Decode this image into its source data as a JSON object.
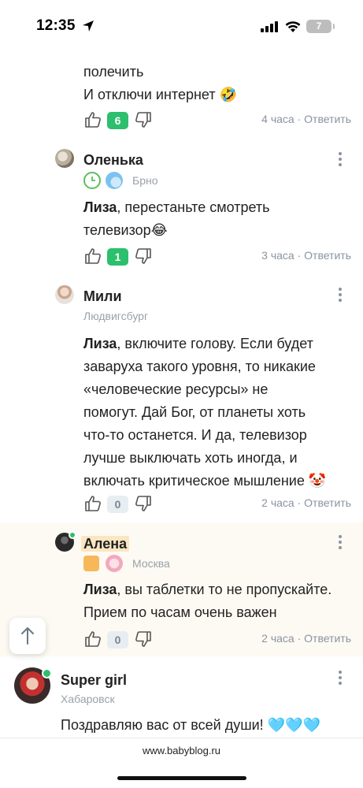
{
  "status_bar": {
    "time": "12:35",
    "battery": "7"
  },
  "comments": [
    {
      "id": "partial",
      "lines": [
        "полечить",
        "И отключи интернет 🤣"
      ],
      "rating": "6",
      "time": "4 часа",
      "reply": "Ответить"
    },
    {
      "id": "olenka",
      "author": "Оленька",
      "location": "Брно",
      "mention": "Лиза",
      "lines": [
        ", перестаньте смотреть",
        "телевизор😂"
      ],
      "rating": "1",
      "time": "3 часа",
      "reply": "Ответить"
    },
    {
      "id": "mili",
      "author": "Мили",
      "location": "Людвигсбург",
      "mention": "Лиза",
      "lines": [
        ", включите голову. Если будет",
        "заваруха такого уровня, то никакие",
        "«человеческие ресурсы» не",
        "помогут. Дай Бог, от планеты хоть",
        "что-то останется. И да, телевизор",
        "лучше выключать хоть иногда, и",
        "включать критическое мышление 🤡"
      ],
      "rating": "0",
      "time": "2 часа",
      "reply": "Ответить"
    },
    {
      "id": "alena",
      "author": "Алена",
      "location": "Москва",
      "mention": "Лиза",
      "lines": [
        ", вы таблетки то не пропускайте.",
        "Прием по часам очень важен"
      ],
      "rating": "0",
      "time": "2 часа",
      "reply": "Ответить"
    },
    {
      "id": "supergirl",
      "author": "Super girl",
      "location": "Хабаровск",
      "lines": [
        "Поздравляю вас от всей души! 🩵🩵🩵"
      ]
    }
  ],
  "footer": {
    "url": "www.babyblog.ru"
  },
  "colors": {
    "accent_green": "#2cbf6d",
    "muted": "#8a93a0",
    "highlight": "#fbe6c2"
  }
}
